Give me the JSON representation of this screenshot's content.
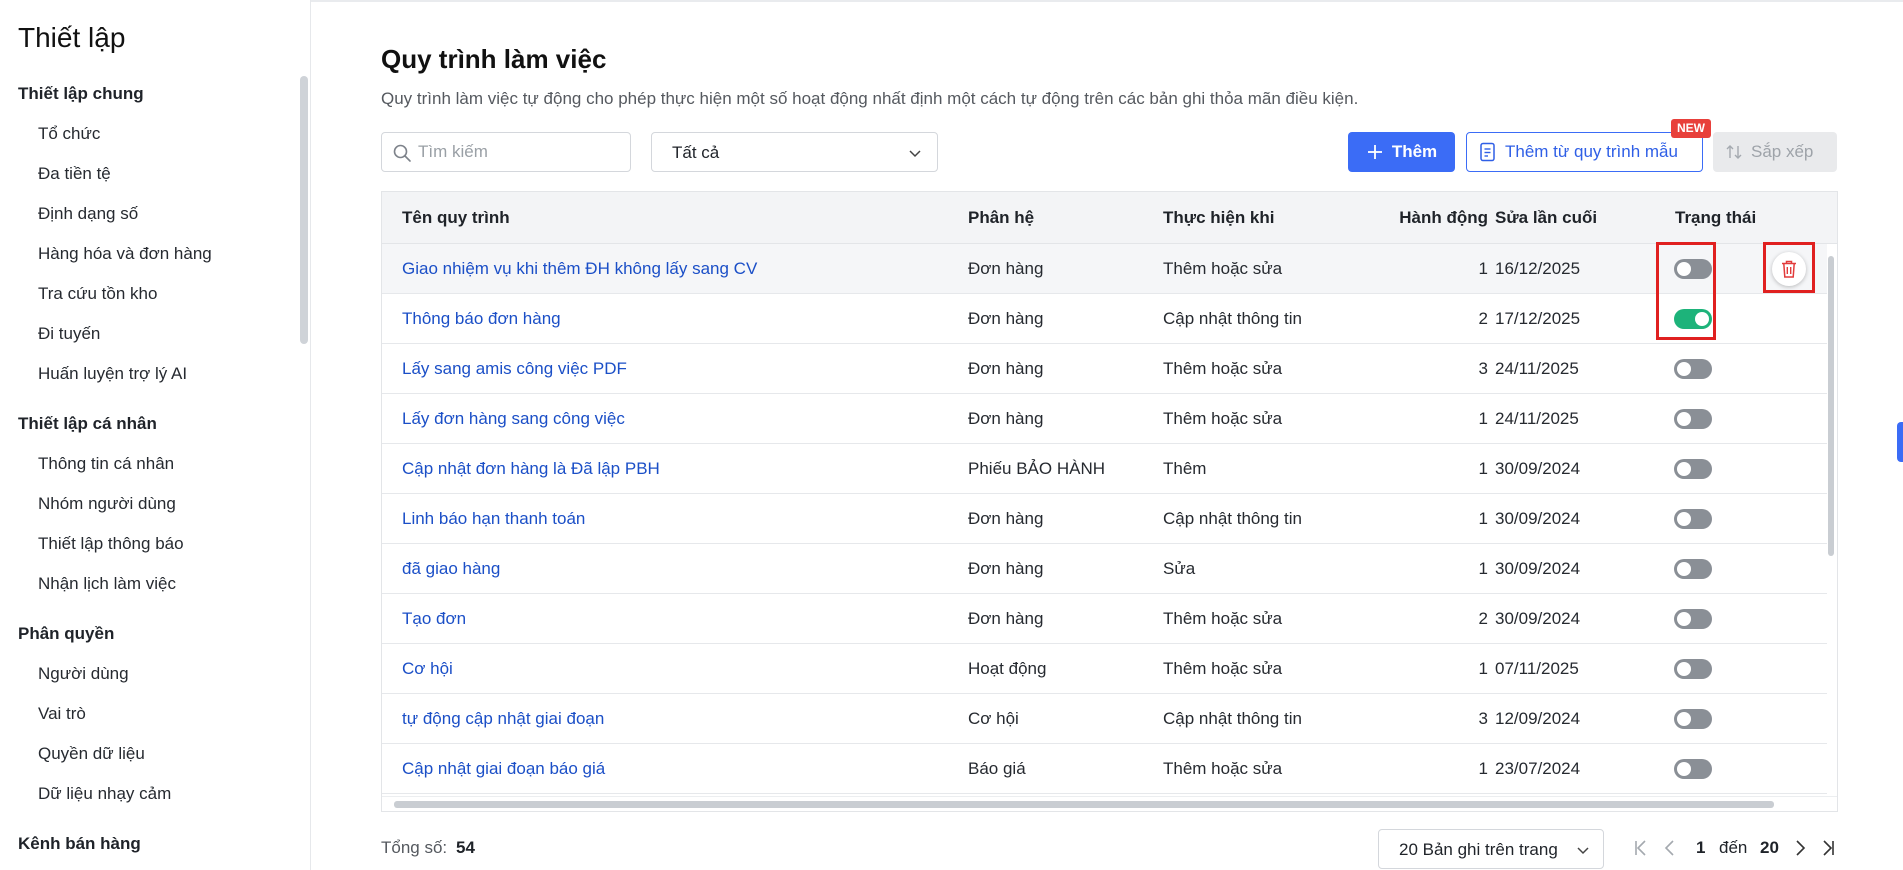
{
  "sidebar": {
    "title": "Thiết lập",
    "groups": [
      {
        "title": "Thiết lập chung",
        "items": [
          "Tổ chức",
          "Đa tiền tệ",
          "Định dạng số",
          "Hàng hóa và đơn hàng",
          "Tra cứu tồn kho",
          "Đi tuyến",
          "Huấn luyện trợ lý AI"
        ]
      },
      {
        "title": "Thiết lập cá nhân",
        "items": [
          "Thông tin cá nhân",
          "Nhóm người dùng",
          "Thiết lập thông báo",
          "Nhận lịch làm việc"
        ]
      },
      {
        "title": "Phân quyền",
        "items": [
          "Người dùng",
          "Vai trò",
          "Quyền dữ liệu",
          "Dữ liệu nhạy cảm"
        ]
      },
      {
        "title": "Kênh bán hàng",
        "items": []
      }
    ]
  },
  "page": {
    "title": "Quy trình làm việc",
    "description": "Quy trình làm việc tự động cho phép thực hiện một số hoạt động nhất định một cách tự động trên các bản ghi thỏa mãn điều kiện."
  },
  "toolbar": {
    "search_placeholder": "Tìm kiếm",
    "filter_value": "Tất cả",
    "add_label": "Thêm",
    "template_label": "Thêm từ quy trình mẫu",
    "new_badge": "NEW",
    "sort_label": "Sắp xếp"
  },
  "table": {
    "columns": [
      "Tên quy trình",
      "Phân hệ",
      "Thực hiện khi",
      "Hành động",
      "Sửa lần cuối",
      "Trạng thái"
    ],
    "rows": [
      {
        "name": "Giao nhiệm vụ khi thêm ĐH không lấy sang CV",
        "module": "Đơn hàng",
        "trigger": "Thêm hoặc sửa",
        "actions": "1",
        "modified": "16/12/2025",
        "active": false
      },
      {
        "name": "Thông báo đơn hàng",
        "module": "Đơn hàng",
        "trigger": "Cập nhật thông tin",
        "actions": "2",
        "modified": "17/12/2025",
        "active": true
      },
      {
        "name": "Lấy sang amis công việc PDF",
        "module": "Đơn hàng",
        "trigger": "Thêm hoặc sửa",
        "actions": "3",
        "modified": "24/11/2025",
        "active": false
      },
      {
        "name": "Lấy đơn hàng sang công việc",
        "module": "Đơn hàng",
        "trigger": "Thêm hoặc sửa",
        "actions": "1",
        "modified": "24/11/2025",
        "active": false
      },
      {
        "name": "Cập nhật đơn hàng là Đã lập PBH",
        "module": "Phiếu BẢO HÀNH",
        "trigger": "Thêm",
        "actions": "1",
        "modified": "30/09/2024",
        "active": false
      },
      {
        "name": "Linh báo hạn thanh toán",
        "module": "Đơn hàng",
        "trigger": "Cập nhật thông tin",
        "actions": "1",
        "modified": "30/09/2024",
        "active": false
      },
      {
        "name": "đã giao hàng",
        "module": "Đơn hàng",
        "trigger": "Sửa",
        "actions": "1",
        "modified": "30/09/2024",
        "active": false
      },
      {
        "name": "Tạo đơn",
        "module": "Đơn hàng",
        "trigger": "Thêm hoặc sửa",
        "actions": "2",
        "modified": "30/09/2024",
        "active": false
      },
      {
        "name": "Cơ hội",
        "module": "Hoạt động",
        "trigger": "Thêm hoặc sửa",
        "actions": "1",
        "modified": "07/11/2025",
        "active": false
      },
      {
        "name": "tự động cập nhật giai đoạn",
        "module": "Cơ hội",
        "trigger": "Cập nhật thông tin",
        "actions": "3",
        "modified": "12/09/2024",
        "active": false
      },
      {
        "name": "Cập nhật giai đoạn báo giá",
        "module": "Báo giá",
        "trigger": "Thêm hoặc sửa",
        "actions": "1",
        "modified": "23/07/2024",
        "active": false
      }
    ]
  },
  "footer": {
    "total_label": "Tổng số:",
    "total_value": "54",
    "page_size": "20 Bản ghi trên trang",
    "range_start": "1",
    "range_sep": "đến",
    "range_end": "20"
  },
  "colors": {
    "accent": "#3b6cf6",
    "link": "#1b4fc7",
    "toggle_on": "#1db37a",
    "toggle_off": "#8a8f96",
    "highlight": "#e02020",
    "badge": "#e8403b"
  },
  "icons": [
    "search-icon",
    "chevron-down-icon",
    "plus-icon",
    "document-icon",
    "sort-icon",
    "trash-icon",
    "first-page-icon",
    "prev-page-icon",
    "next-page-icon",
    "last-page-icon"
  ]
}
